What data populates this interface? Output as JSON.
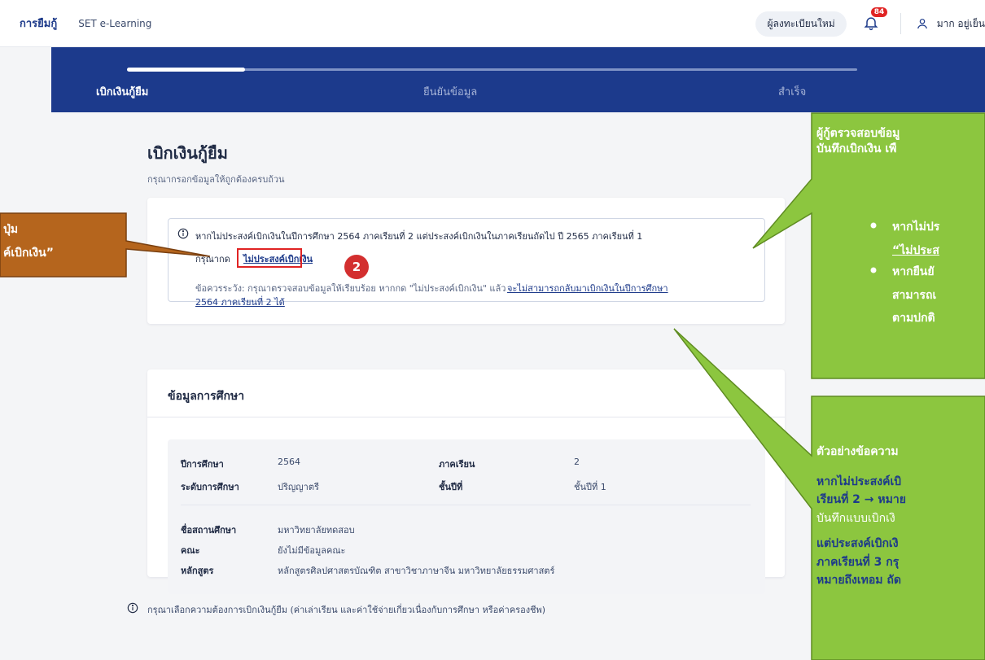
{
  "topbar": {
    "brand": "การยืมกู้",
    "nav_link": "SET e-Learning",
    "register_button": "ผู้ลงทะเบียนใหม่",
    "notification_count": "84",
    "user_name": "มาก อยู่เย็น"
  },
  "stepper": {
    "steps": [
      {
        "label": "เบิกเงินกู้ยืม",
        "state": "active"
      },
      {
        "label": "ยืนยันข้อมูล",
        "state": "pending"
      },
      {
        "label": "สำเร็จ",
        "state": "pending"
      }
    ]
  },
  "page": {
    "title": "เบิกเงินกู้ยืม",
    "subtitle": "กรุณากรอกข้อมูลให้ถูกต้องครบถ้วน"
  },
  "notice": {
    "line1": "หากไม่ประสงค์เบิกเงินในปีการศึกษา 2564 ภาคเรียนที่ 2 แต่ประสงค์เบิกเงินในภาคเรียนถัดไป ปี 2565 ภาคเรียนที่ 1",
    "line2_prefix": "กรุณากด",
    "decline_link": "ไม่ประสงค์เบิกเงิน",
    "badge_number": "2",
    "warning_prefix": "ข้อควรระวัง: กรุณาตรวจสอบข้อมูลให้เรียบร้อย หากกด \"ไม่ประสงค์เบิกเงิน\" แล้ว",
    "warning_link_1": "จะไม่สามารถกลับมาเบิกเงินในปีการศึกษา",
    "warning_link_2": "2564 ภาคเรียนที่ 2 ได้"
  },
  "education": {
    "title": "ข้อมูลการศึกษา",
    "academic_year_label": "ปีการศึกษา",
    "academic_year_value": "2564",
    "semester_label": "ภาคเรียน",
    "semester_value": "2",
    "level_label": "ระดับการศึกษา",
    "level_value": "ปริญญาตรี",
    "year_level_label": "ชั้นปีที่",
    "year_level_value": "ชั้นปีที่ 1",
    "institution_label": "ชื่อสถานศึกษา",
    "institution_value": "มหาวิทยาลัยทดสอบ",
    "faculty_label": "คณะ",
    "faculty_value": "ยังไม่มีข้อมูลคณะ",
    "program_label": "หลักสูตร",
    "program_value": "หลักสูตรศิลปศาสตรบัณฑิต สาขาวิชาภาษาจีน มหาวิทยาลัยธรรมศาสตร์"
  },
  "footer_note": "กรุณาเลือกความต้องการเบิกเงินกู้ยืม (ค่าเล่าเรียน และค่าใช้จ่ายเกี่ยวเนื่องกับการศึกษา หรือค่าครองชีพ)",
  "callouts": {
    "left_line1": "ปุ่ม",
    "left_line2": "ค์เบิกเงิน”",
    "right_top_line1": "ผู้กู้ตรวจสอบข้อมู",
    "right_top_line2": "บันทึกเบิกเงิน เพื",
    "right_top_bullet1_a": "หากไม่ปร",
    "right_top_bullet1_b": "“ไม่ประส",
    "right_top_bullet2_a": "หากยืนยั",
    "right_top_bullet2_b": "สามารถเ",
    "right_top_bullet2_c": "ตามปกติ",
    "right_bottom_line1": "ตัวอย่างข้อความ",
    "right_bottom_line2": "หากไม่ประสงค์เบิ",
    "right_bottom_line3": "เรียนที่ 2 → หมาย",
    "right_bottom_line4": "บันทึกแบบเบิกเงิ",
    "right_bottom_line5": "แต่ประสงค์เบิกเงิ",
    "right_bottom_line6": "ภาคเรียนที่ 3 กรุ",
    "right_bottom_line7": "หมายถึงเทอม ถัด"
  },
  "colors": {
    "navy": "#1c3a8c",
    "callout_green": "#8cc63f",
    "callout_brown": "#b5651d",
    "highlight_red": "#e02424"
  }
}
